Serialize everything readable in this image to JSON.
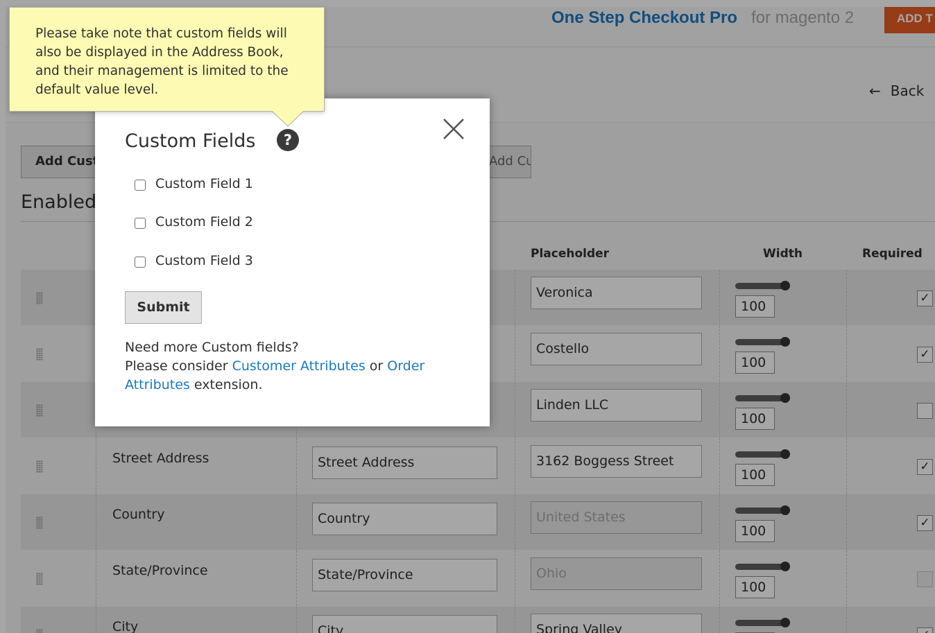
{
  "header": {
    "brand_title": "One Step Checkout Pro",
    "brand_subtitle": "for magento 2",
    "add_button_label": "ADD T",
    "back_label": "Back"
  },
  "toolbar": {
    "add_custom_label": "Add Custom Field",
    "attribute_label": "Add Customer Attribute"
  },
  "section": {
    "title": "Enabled Fields"
  },
  "table": {
    "headers": {
      "placeholder": "Placeholder",
      "width": "Width",
      "required": "Required"
    },
    "rows": [
      {
        "field": "",
        "label": "",
        "placeholder": "Veronica",
        "width": "100",
        "required": true,
        "required_enabled": true,
        "placeholder_disabled": false
      },
      {
        "field": "",
        "label": "",
        "placeholder": "Costello",
        "width": "100",
        "required": true,
        "required_enabled": true,
        "placeholder_disabled": false
      },
      {
        "field": "",
        "label": "",
        "placeholder": "Linden LLC",
        "width": "100",
        "required": false,
        "required_enabled": true,
        "placeholder_disabled": false
      },
      {
        "field": "Street Address",
        "label": "Street Address",
        "placeholder": "3162 Boggess Street",
        "width": "100",
        "required": true,
        "required_enabled": true,
        "placeholder_disabled": false
      },
      {
        "field": "Country",
        "label": "Country",
        "placeholder": "United States",
        "width": "100",
        "required": true,
        "required_enabled": true,
        "placeholder_disabled": true
      },
      {
        "field": "State/Province",
        "label": "State/Province",
        "placeholder": "Ohio",
        "width": "100",
        "required": false,
        "required_enabled": false,
        "placeholder_disabled": true
      },
      {
        "field": "City",
        "label": "City",
        "placeholder": "Spring Valley",
        "width": "100",
        "required": true,
        "required_enabled": true,
        "placeholder_disabled": false
      }
    ]
  },
  "modal": {
    "title": "Custom Fields",
    "items": [
      {
        "label": "Custom Field 1",
        "checked": false
      },
      {
        "label": "Custom Field 2",
        "checked": false
      },
      {
        "label": "Custom Field 3",
        "checked": false
      }
    ],
    "submit_label": "Submit",
    "more_line1": "Need more Custom fields?",
    "more_prefix": "Please consider ",
    "link_customer": "Customer Attributes",
    "more_or": " or ",
    "link_order": "Order Attributes",
    "more_suffix": " extension."
  },
  "tooltip": {
    "text": "Please take note that custom fields will also be displayed in the Address Book, and their management is limited to the default value level."
  },
  "colors": {
    "brand": "#1979c3",
    "accent": "#e85d22",
    "tooltip_bg": "#fdfbb3"
  }
}
